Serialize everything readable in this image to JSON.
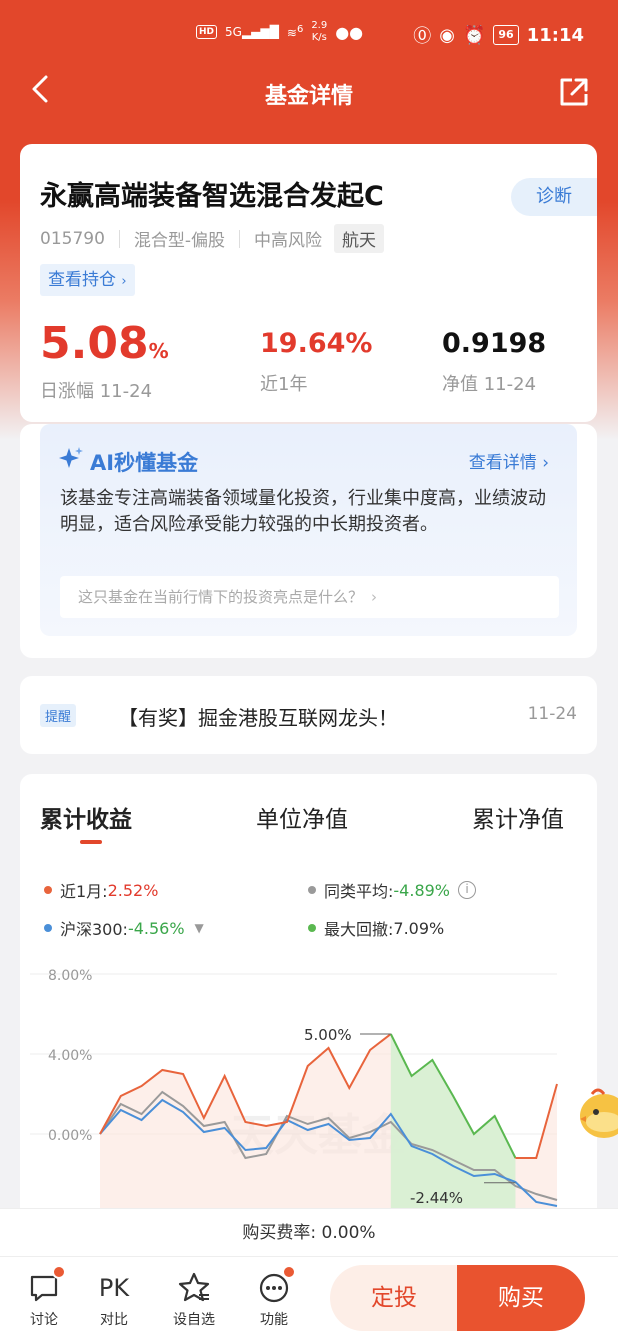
{
  "status_bar": {
    "hd": "HD",
    "signal": "5G",
    "wifi_signal": "6",
    "speed_value": "2.9",
    "speed_unit": "K/s",
    "battery": "96",
    "time": "11:14"
  },
  "nav": {
    "title": "基金详情"
  },
  "fund": {
    "name": "永赢高端装备智选混合发起C",
    "diagnose_label": "诊断",
    "code": "015790",
    "type": "混合型-偏股",
    "risk": "中高风险",
    "theme_tag": "航天",
    "holdings_label": "查看持仓",
    "daily_change_value": "5.08",
    "daily_change_unit": "%",
    "daily_change_label": "日涨幅 11-24",
    "year_return": "19.64%",
    "year_return_label": "近1年",
    "nav_value": "0.9198",
    "nav_label": "净值 11-24"
  },
  "ai": {
    "title": "AI秒懂基金",
    "more_label": "查看详情",
    "description": "该基金专注高端装备领域量化投资，行业集中度高，业绩波动明显，适合风险承受能力较强的中长期投资者。",
    "question": "这只基金在当前行情下的投资亮点是什么？"
  },
  "notice": {
    "badge": "提醒",
    "text": "【有奖】掘金港股互联网龙头！",
    "date": "11-24"
  },
  "chart_tabs": [
    "累计收益",
    "单位净值",
    "累计净值"
  ],
  "legend": {
    "fund_label": "近1月:",
    "fund_value": "2.52%",
    "peer_label": "同类平均:",
    "peer_value": "-4.89%",
    "index_label": "沪深300:",
    "index_value": "-4.56%",
    "drawdown_label": "最大回撤:",
    "drawdown_value": "7.09%"
  },
  "colors": {
    "fund": "#e8643c",
    "index": "#4a8fd8",
    "peer": "#9a9a9a",
    "drawdown": "#5ab850"
  },
  "chart_data": {
    "type": "line",
    "yticks": [
      "8.00%",
      "4.00%",
      "0.00%"
    ],
    "ylim": [
      -4,
      8
    ],
    "watermark": "天天基金",
    "annotations": [
      "5.00%",
      "-2.44%"
    ],
    "series": [
      {
        "name": "近1月",
        "values": [
          0.0,
          1.9,
          2.4,
          3.2,
          3.0,
          0.8,
          2.9,
          0.6,
          0.4,
          0.6,
          3.4,
          4.3,
          2.3,
          4.2,
          5.0,
          2.9,
          3.7,
          1.9,
          0.0,
          0.9,
          -1.2,
          -1.2,
          2.5
        ]
      },
      {
        "name": "沪深300",
        "values": [
          0.0,
          1.2,
          0.7,
          1.7,
          1.1,
          0.1,
          0.3,
          -0.8,
          -0.7,
          0.7,
          0.2,
          0.5,
          -0.3,
          -0.2,
          1.0,
          -0.6,
          -1.0,
          -1.6,
          -2.1,
          -2.0,
          -2.4,
          -3.4,
          -3.6
        ]
      },
      {
        "name": "同类平均",
        "values": [
          0.0,
          1.5,
          1.0,
          2.1,
          1.4,
          0.4,
          0.6,
          -1.2,
          -1.0,
          0.9,
          0.5,
          0.8,
          -0.2,
          0.1,
          0.6,
          -0.5,
          -0.8,
          -1.3,
          -1.8,
          -1.8,
          -2.6,
          -3.0,
          -3.3
        ]
      }
    ],
    "drawdown_range": [
      14,
      20
    ],
    "drawdown_high": 5.0,
    "drawdown_low": -2.44
  },
  "fee": {
    "text": "购买费率: 0.00%"
  },
  "bottom_bar": {
    "discuss": "讨论",
    "compare_icon": "PK",
    "compare": "对比",
    "watch": "设自选",
    "features": "功能",
    "dingtou": "定投",
    "buy": "购买"
  }
}
